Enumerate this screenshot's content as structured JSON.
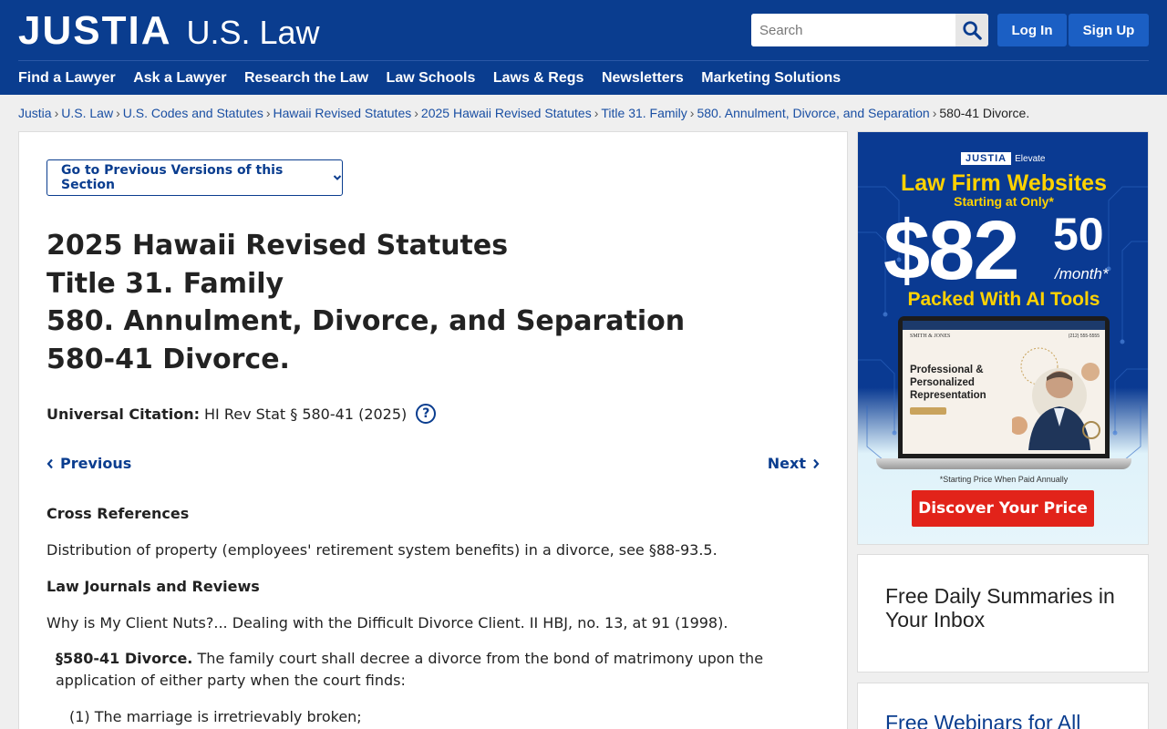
{
  "header": {
    "logo_main": "JUSTIA",
    "logo_sub": "U.S. Law",
    "search_placeholder": "Search",
    "login_label": "Log In",
    "signup_label": "Sign Up",
    "nav": [
      "Find a Lawyer",
      "Ask a Lawyer",
      "Research the Law",
      "Law Schools",
      "Laws & Regs",
      "Newsletters",
      "Marketing Solutions"
    ]
  },
  "breadcrumb": {
    "items": [
      "Justia",
      "U.S. Law",
      "U.S. Codes and Statutes",
      "Hawaii Revised Statutes",
      "2025 Hawaii Revised Statutes",
      "Title 31. Family",
      "580. Annulment, Divorce, and Separation"
    ],
    "current": "580-41 Divorce.",
    "separator": "›"
  },
  "main": {
    "versions_label": "Go to Previous Versions of this Section",
    "title_lines": [
      "2025 Hawaii Revised Statutes",
      "Title 31. Family",
      "580. Annulment, Divorce, and Separation",
      "580-41 Divorce."
    ],
    "citation_label": "Universal Citation:",
    "citation_value": "HI Rev Stat § 580-41 (2025)",
    "help_glyph": "?",
    "prev_label": "Previous",
    "next_label": "Next",
    "cross_ref_heading": "Cross References",
    "cross_ref_text": "Distribution of property (employees' retirement system benefits) in a divorce, see §88-93.5.",
    "journals_heading": "Law Journals and Reviews",
    "journals_text": "Why is My Client Nuts?... Dealing with the Difficult Divorce Client. II HBJ, no. 13, at 91 (1998).",
    "statute_number": "§580-41 Divorce.",
    "statute_text": "The family court shall decree a divorce from the bond of matrimony upon the application of either party when the court finds:",
    "statute_item_1": "(1) The marriage is irretrievably broken;"
  },
  "ad": {
    "badge_brand": "JUSTIA",
    "badge_product": "Elevate",
    "headline": "Law Firm Websites",
    "sub": "Starting at Only*",
    "price_dollars": "$82",
    "price_cents": "50",
    "price_unit": "/month*",
    "packed": "Packed With AI Tools",
    "laptop_firm": "SMITH & JONES",
    "laptop_phone": "(212) 555-5555",
    "laptop_tagline": "Professional & Personalized Representation",
    "fine_print": "*Starting Price When Paid Annually",
    "cta": "Discover Your Price",
    "colors": {
      "navy": "#0a3a92",
      "yellow": "#ffd200",
      "red": "#e2231a"
    }
  },
  "sidebar": {
    "card1_title": "Free Daily Summaries in Your Inbox",
    "card2_title": "Free Webinars for All"
  }
}
